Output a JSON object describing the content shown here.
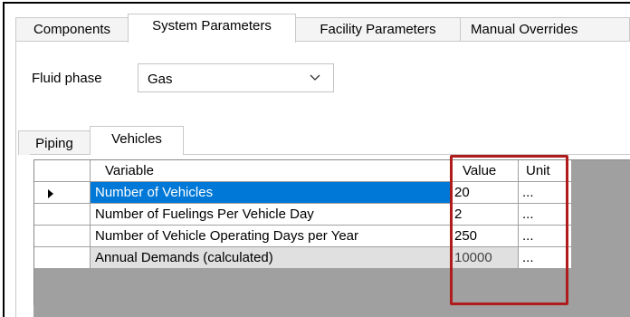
{
  "top_tabs": [
    {
      "label": "Components",
      "active": false
    },
    {
      "label": "System Parameters",
      "active": true
    },
    {
      "label": "Facility Parameters",
      "active": false
    },
    {
      "label": "Manual Overrides",
      "active": false
    }
  ],
  "fluid_phase": {
    "label": "Fluid phase",
    "value": "Gas"
  },
  "inner_tabs": [
    {
      "label": "Piping",
      "active": false
    },
    {
      "label": "Vehicles",
      "active": true
    }
  ],
  "grid": {
    "headers": {
      "variable": "Variable",
      "value": "Value",
      "unit": "Unit"
    },
    "rows": [
      {
        "variable": "Number of Vehicles",
        "value": "20",
        "unit": "...",
        "selected": true
      },
      {
        "variable": "Number of Fuelings Per Vehicle Day",
        "value": "2",
        "unit": "...",
        "selected": false
      },
      {
        "variable": "Number of Vehicle Operating Days per Year",
        "value": "250",
        "unit": "...",
        "selected": false
      },
      {
        "variable": "Annual Demands (calculated)",
        "value": "10000",
        "unit": "...",
        "selected": false,
        "calculated": true
      }
    ]
  },
  "colors": {
    "selection": "#0078d7",
    "highlight_box": "#b01c1c",
    "grid_background": "#a0a0a0"
  }
}
